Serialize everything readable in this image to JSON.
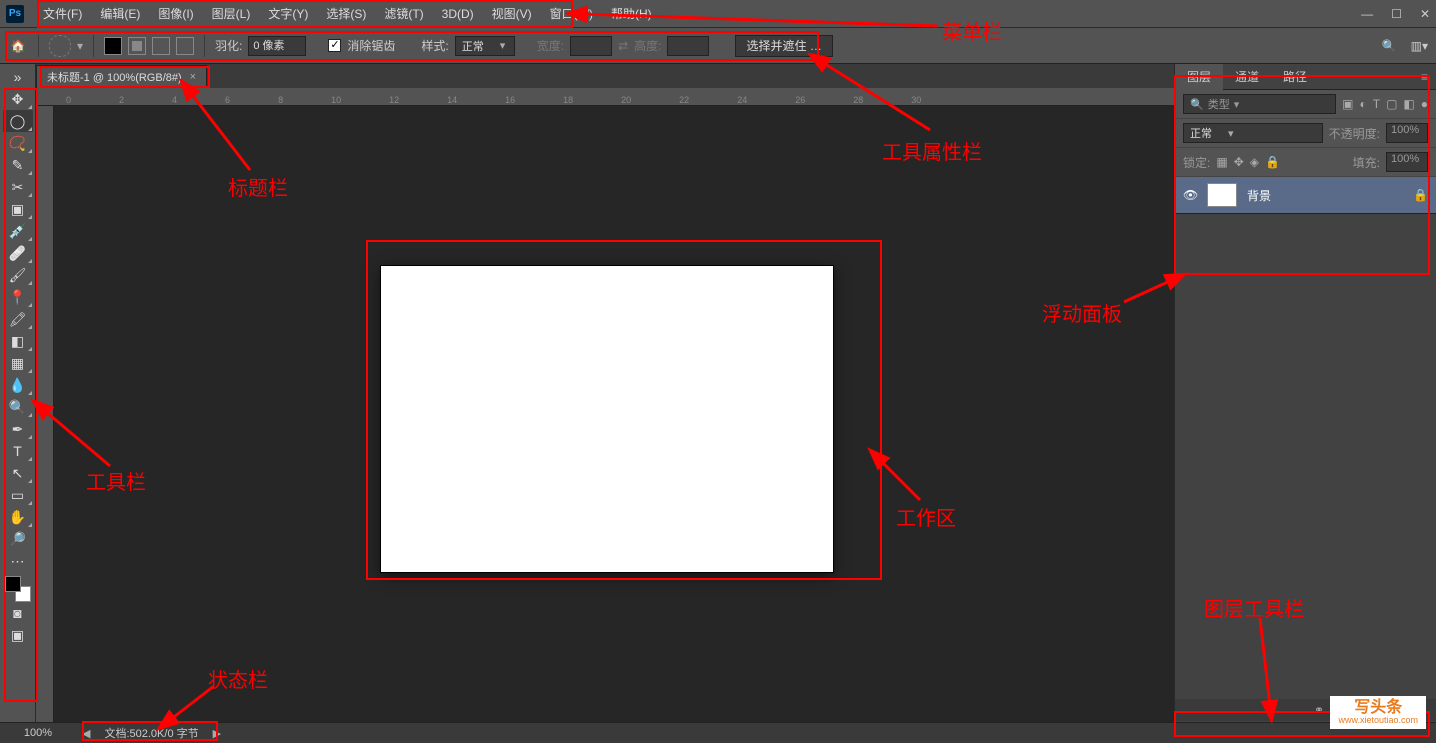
{
  "menu": {
    "items": [
      "文件(F)",
      "编辑(E)",
      "图像(I)",
      "图层(L)",
      "文字(Y)",
      "选择(S)",
      "滤镜(T)",
      "3D(D)",
      "视图(V)",
      "窗口(W)",
      "帮助(H)"
    ]
  },
  "options": {
    "feather_label": "羽化:",
    "feather_value": "0 像素",
    "antialias": "消除锯齿",
    "style_label": "样式:",
    "style_value": "正常",
    "width_label": "宽度:",
    "height_label": "高度:",
    "select_mask": "选择并遮住 …"
  },
  "tab": {
    "title": "未标题-1 @ 100%(RGB/8#)"
  },
  "ruler": [
    "0",
    "2",
    "4",
    "6",
    "8",
    "10",
    "12",
    "14",
    "16",
    "18",
    "20",
    "22",
    "24",
    "26",
    "28",
    "30"
  ],
  "panels": {
    "tabs": [
      "图层",
      "通道",
      "路径"
    ],
    "search_placeholder": "类型",
    "blend": "正常",
    "opacity_label": "不透明度:",
    "opacity_value": "100%",
    "lock_label": "锁定:",
    "fill_label": "填充:",
    "fill_value": "100%",
    "layer_name": "背景"
  },
  "status": {
    "zoom": "100%",
    "doc": "文档:502.0K/0 字节"
  },
  "annotations": {
    "menu": "菜单栏",
    "options": "工具属性栏",
    "title": "标题栏",
    "tools": "工具栏",
    "work": "工作区",
    "status": "状态栏",
    "float": "浮动面板",
    "layertools": "图层工具栏"
  },
  "watermark": {
    "brand": "写头条",
    "url": "www.xietoutiao.com"
  }
}
